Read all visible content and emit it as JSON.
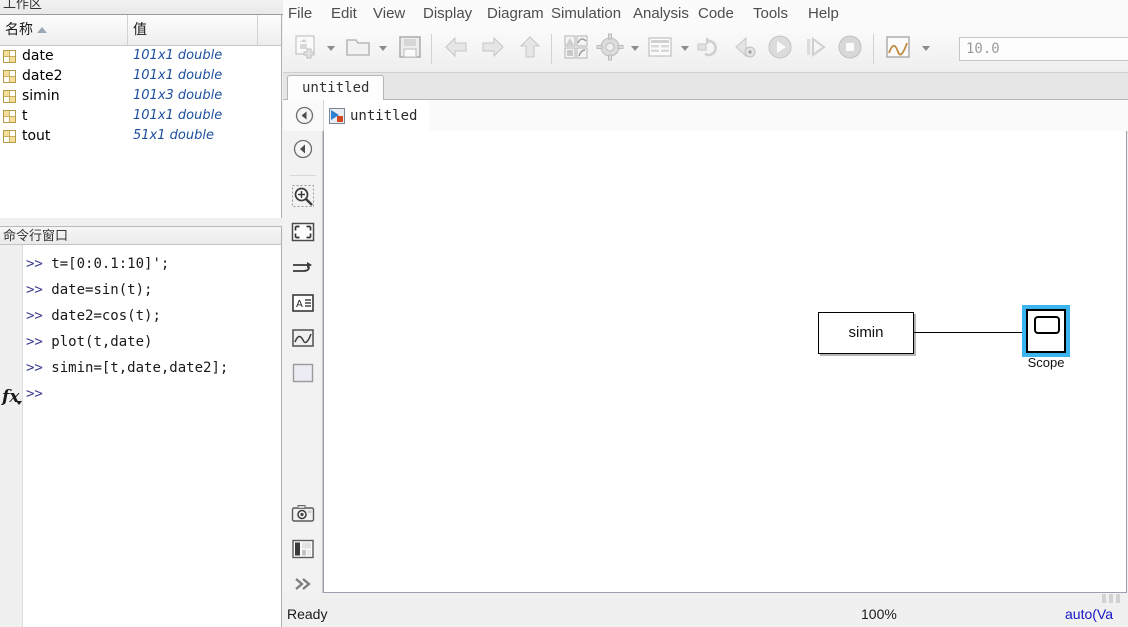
{
  "matlab": {
    "workspace": {
      "title": "工作区",
      "columns": [
        "名称",
        "值"
      ],
      "sort_indicator": "sort-ascending-icon",
      "rows": [
        {
          "name": "date",
          "value": "101x1 double"
        },
        {
          "name": "date2",
          "value": "101x1 double"
        },
        {
          "name": "simin",
          "value": "101x3 double"
        },
        {
          "name": "t",
          "value": "101x1 double"
        },
        {
          "name": "tout",
          "value": "51x1 double"
        }
      ]
    },
    "command_window": {
      "title": "命令行窗口",
      "prompt": ">>",
      "fx_icon": "fx-icon",
      "lines": [
        "t=[0:0.1:10]';",
        "date=sin(t);",
        "date2=cos(t);",
        "plot(t,date)",
        "simin=[t,date,date2];",
        ""
      ]
    }
  },
  "simulink": {
    "menus": [
      "File",
      "Edit",
      "View",
      "Display",
      "Diagram",
      "Simulation",
      "Analysis",
      "Code",
      "Tools",
      "Help"
    ],
    "toolbar": {
      "new_model": "new-model-icon",
      "open": "open-folder-icon",
      "save": "save-icon",
      "back": "back-arrow-icon",
      "forward": "forward-arrow-icon",
      "up": "up-arrow-icon",
      "library": "library-browser-icon",
      "model_settings": "gear-icon",
      "model_explorer": "model-explorer-icon",
      "update_model": "update-model-icon",
      "step_back": "step-back-icon",
      "run": "run-icon",
      "step_forward": "step-forward-icon",
      "stop": "stop-icon",
      "scope_view": "scope-icon",
      "sim_time_value": "10.0"
    },
    "tab": {
      "label": "untitled"
    },
    "breadcrumb": {
      "back_icon": "back-circle-icon",
      "model_icon": "simulink-model-icon",
      "label": "untitled"
    },
    "sidebar": [
      "back-circle-icon",
      "zoom-in-icon",
      "fit-to-view-icon",
      "signal-routing-icon",
      "annotation-icon",
      "scope-viewer-icon",
      "block-icon",
      "camera-icon",
      "library-icon",
      "expand-chevron-icon"
    ],
    "canvas": {
      "blocks": [
        {
          "name": "simin",
          "label": "simin",
          "selected": false
        },
        {
          "name": "scope",
          "label": "Scope",
          "selected": true
        }
      ]
    },
    "statusbar": {
      "status": "Ready",
      "zoom": "100%",
      "solver": "auto(Va"
    }
  },
  "colors": {
    "selection": "#3cb4ef",
    "value_text": "#1b4f9c",
    "solver_text": "#1414c8"
  }
}
